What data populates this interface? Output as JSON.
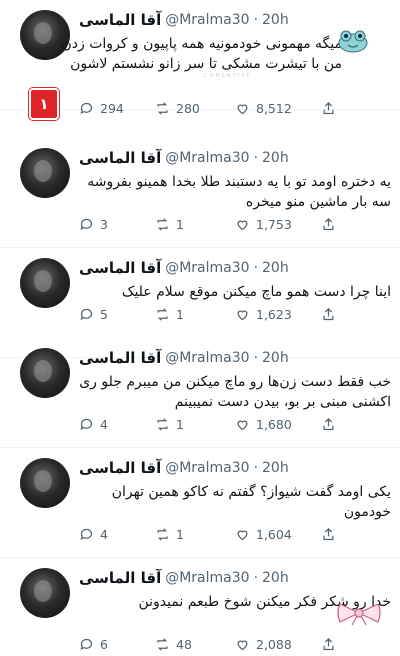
{
  "tweets": [
    {
      "name": "آقا الماسی",
      "handle": "@Mralma30",
      "time": "20h",
      "text": "میگه مهمونی خودمونیه همه پاپیون و کروات زدن من با تیشرت مشکی تا سر زانو نشستم لاشون",
      "replies": "294",
      "retweets": "280",
      "likes": "8,512"
    },
    {
      "name": "آقا الماسی",
      "handle": "@Mralma30",
      "time": "20h",
      "text": "یه دختره اومد تو با یه دستبند طلا بخدا همینو بفروشه سه بار ماشین منو میخره",
      "replies": "3",
      "retweets": "1",
      "likes": "1,753"
    },
    {
      "name": "آقا الماسی",
      "handle": "@Mralma30",
      "time": "20h",
      "text": "اینا چرا دست همو ماچ میکنن موقع سلام علیک",
      "replies": "5",
      "retweets": "1",
      "likes": "1,623"
    },
    {
      "name": "آقا الماسی",
      "handle": "@Mralma30",
      "time": "20h",
      "text": "خب فقط دست زن‌ها رو ماچ میکنن من میبرم جلو ری اکشنی مبنی بر بو، بیدن دست نمیبینم",
      "replies": "4",
      "retweets": "1",
      "likes": "1,680"
    },
    {
      "name": "آقا الماسی",
      "handle": "@Mralma30",
      "time": "20h",
      "text": "یکی اومد گفت شیواز؟ گفتم نه کاکو همین تهران خودمون",
      "replies": "4",
      "retweets": "1",
      "likes": "1,604"
    },
    {
      "name": "آقا الماسی",
      "handle": "@Mralma30",
      "time": "20h",
      "text": "خدا رو شکر فکر میکنن شوخ طبعم نمیدونن",
      "replies": "6",
      "retweets": "48",
      "likes": "2,088"
    }
  ],
  "badge": "١",
  "watermark": "COMENTIVE",
  "trailing_dots": "..",
  "icons": {
    "reply": "reply-icon",
    "retweet": "retweet-icon",
    "like": "heart-icon",
    "share": "share-icon"
  },
  "colors": {
    "text": "#0f1419",
    "muted": "#536471",
    "badge": "#e0242b"
  }
}
